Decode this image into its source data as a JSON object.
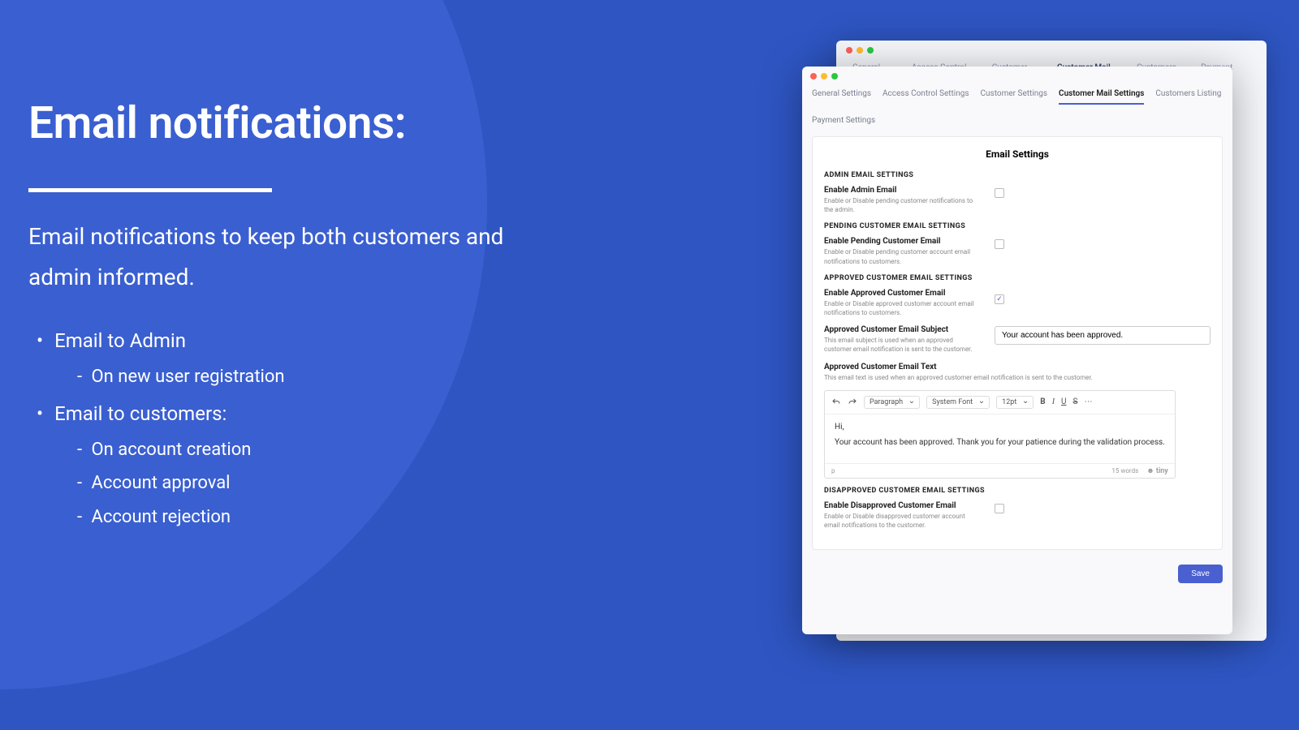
{
  "left": {
    "title": "Email notifications:",
    "subtitle": "Email notifications to keep both customers and admin informed.",
    "b1": "Email to Admin",
    "b1_s1": "On new user registration",
    "b2": "Email to customers:",
    "b2_s1": "On account creation",
    "b2_s2": "Account approval",
    "b2_s3": "Account rejection"
  },
  "tabs": {
    "t1": "General Settings",
    "t2": "Access Control Settings",
    "t3": "Customer Settings",
    "t4": "Customer Mail Settings",
    "t5": "Customers Listing",
    "t6": "Payment Settings"
  },
  "panel": {
    "title": "Email Settings",
    "admin_h": "ADMIN EMAIL SETTINGS",
    "admin_label": "Enable Admin Email",
    "admin_desc": "Enable or Disable pending customer notifications to the admin.",
    "pending_h": "PENDING CUSTOMER EMAIL SETTINGS",
    "pending_label": "Enable Pending Customer Email",
    "pending_desc": "Enable or Disable pending customer account email notifications to customers.",
    "approved_h": "APPROVED CUSTOMER EMAIL SETTINGS",
    "approved_enable_label": "Enable Approved Customer Email",
    "approved_enable_desc": "Enable or Disable approved customer account email notifications to customers.",
    "approved_subj_label": "Approved Customer Email Subject",
    "approved_subj_desc": "This email subject is used when an approved customer email notification is sent to the customer.",
    "approved_subj_value": "Your account has been approved.",
    "approved_text_label": "Approved Customer Email Text",
    "approved_text_desc": "This email text is used when an approved customer email notification is sent to the customer.",
    "editor": {
      "para": "Paragraph",
      "font": "System Font",
      "size": "12pt",
      "line1": "Hi,",
      "line2": "Your account has been approved. Thank you for your patience during the validation process.",
      "path": "p",
      "words": "15 words",
      "tiny": "tiny"
    },
    "disapproved_h": "DISAPPROVED CUSTOMER EMAIL SETTINGS",
    "disapproved_label": "Enable Disapproved Customer Email",
    "disapproved_desc": "Enable or Disable disapproved customer account email notifications to the customer.",
    "save": "Save"
  }
}
